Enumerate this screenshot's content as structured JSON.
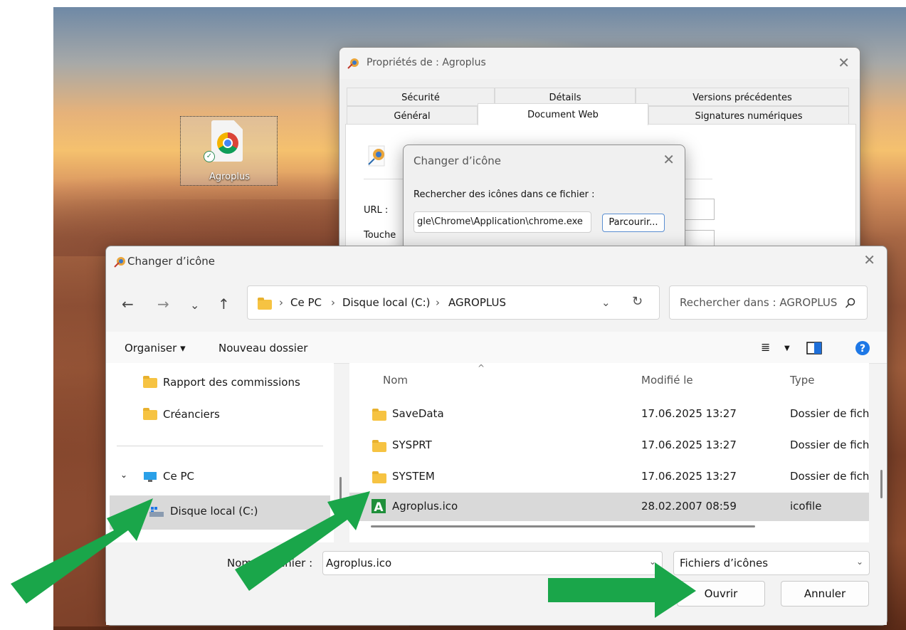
{
  "desktop": {
    "shortcut_label": "Agroplus"
  },
  "properties": {
    "title": "Propriétés de : Agroplus",
    "tabs_row1": [
      "Sécurité",
      "Détails",
      "Versions précédentes"
    ],
    "tabs_row2": [
      "Général",
      "Document Web",
      "Signatures numériques"
    ],
    "url_label": "URL :",
    "hotkey_label": "Touche"
  },
  "change_icon_small": {
    "title": "Changer d’icône",
    "search_label": "Rechercher des icônes dans ce fichier :",
    "path_value": "gle\\Chrome\\Application\\chrome.exe",
    "browse_button": "Parcourir..."
  },
  "file_dialog": {
    "title": "Changer d’icône",
    "breadcrumb": [
      "Ce PC",
      "Disque local (C:)",
      "AGROPLUS"
    ],
    "search_placeholder": "Rechercher dans : AGROPLUS",
    "toolbar": {
      "organize": "Organiser ▾",
      "new_folder": "Nouveau dossier"
    },
    "nav_items": [
      "Rapport des commissions",
      "Créanciers",
      "Ce PC",
      "Disque local (C:)"
    ],
    "columns": [
      "Nom",
      "Modifié le",
      "Type"
    ],
    "rows": [
      {
        "name": "SaveData",
        "modified": "17.06.2025 13:27",
        "type": "Dossier de fich"
      },
      {
        "name": "SYSPRT",
        "modified": "17.06.2025 13:27",
        "type": "Dossier de fich"
      },
      {
        "name": "SYSTEM",
        "modified": "17.06.2025 13:27",
        "type": "Dossier de fich"
      },
      {
        "name": "Agroplus.ico",
        "modified": "28.02.2007 08:59",
        "type": "icofile"
      }
    ],
    "filename_label": "Nom du fichier :",
    "filename_value": "Agroplus.ico",
    "filetype_value": "Fichiers d’icônes",
    "open_button": "Ouvrir",
    "cancel_button": "Annuler"
  },
  "colors": {
    "arrow": "#1aa64a",
    "folder": "#f6c342",
    "selection": "#d9d9d9"
  }
}
